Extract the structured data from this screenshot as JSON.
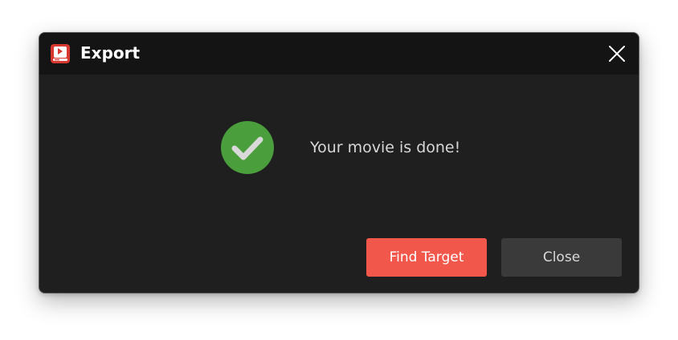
{
  "window": {
    "title": "Export",
    "app_icon": "app-logo-icon",
    "close_icon": "close-icon"
  },
  "content": {
    "status_icon": "check-circle-icon",
    "message": "Your movie is done!"
  },
  "buttons": {
    "primary_label": "Find Target",
    "secondary_label": "Close"
  },
  "colors": {
    "dialog_bg": "#1f1f1f",
    "titlebar_bg": "#141414",
    "accent": "#f1574a",
    "success": "#4a9e3c",
    "secondary_button": "#3a3a3a"
  }
}
